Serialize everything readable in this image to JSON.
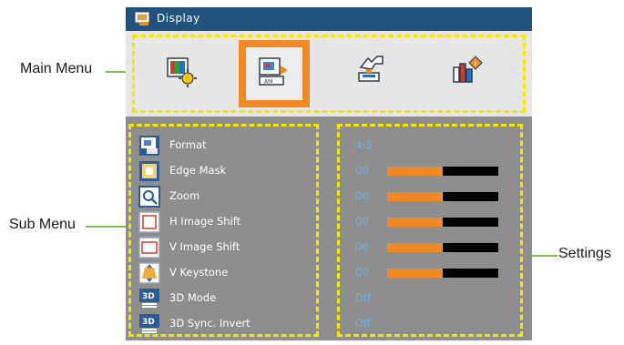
{
  "window": {
    "title": "Display"
  },
  "main_menu": {
    "items": [
      {
        "name": "image-menu-icon",
        "selected": false
      },
      {
        "name": "display-menu-icon",
        "selected": true
      },
      {
        "name": "setup-menu-icon",
        "selected": false
      },
      {
        "name": "options-menu-icon",
        "selected": false
      }
    ]
  },
  "sub_menu": {
    "items": [
      {
        "label": "Format",
        "value": "4:3",
        "icon": "format-icon",
        "level": null
      },
      {
        "label": "Edge Mask",
        "value": "00",
        "icon": "edge-mask-icon",
        "level": 0.5
      },
      {
        "label": "Zoom",
        "value": "00",
        "icon": "zoom-icon",
        "level": 0.5
      },
      {
        "label": "H Image Shift",
        "value": "00",
        "icon": "h-image-shift-icon",
        "level": 0.5
      },
      {
        "label": "V Image Shift",
        "value": "00",
        "icon": "v-image-shift-icon",
        "level": 0.5
      },
      {
        "label": "V Keystone",
        "value": "00",
        "icon": "v-keystone-icon",
        "level": 0.5
      },
      {
        "label": "3D Mode",
        "value": "Off",
        "icon": "3d-mode-icon",
        "level": null
      },
      {
        "label": "3D Sync. Invert",
        "value": "Off",
        "icon": "3d-sync-invert-icon",
        "level": null
      }
    ]
  },
  "callouts": {
    "main_menu": "Main Menu",
    "sub_menu": "Sub Menu",
    "settings": "Settings"
  },
  "colors": {
    "title_bar": "#20527c",
    "panel": "#8e8e8e",
    "highlight_dash": "#f5e600",
    "selection": "#ef8a27",
    "value_text": "#6fb4ea",
    "callout_line": "#7dc142"
  }
}
